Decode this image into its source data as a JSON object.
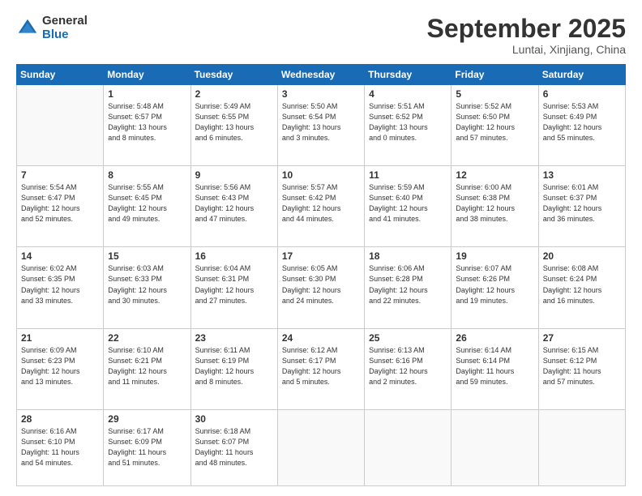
{
  "logo": {
    "general": "General",
    "blue": "Blue"
  },
  "header": {
    "month": "September 2025",
    "location": "Luntai, Xinjiang, China"
  },
  "weekdays": [
    "Sunday",
    "Monday",
    "Tuesday",
    "Wednesday",
    "Thursday",
    "Friday",
    "Saturday"
  ],
  "weeks": [
    [
      {
        "day": "",
        "info": ""
      },
      {
        "day": "1",
        "info": "Sunrise: 5:48 AM\nSunset: 6:57 PM\nDaylight: 13 hours\nand 8 minutes."
      },
      {
        "day": "2",
        "info": "Sunrise: 5:49 AM\nSunset: 6:55 PM\nDaylight: 13 hours\nand 6 minutes."
      },
      {
        "day": "3",
        "info": "Sunrise: 5:50 AM\nSunset: 6:54 PM\nDaylight: 13 hours\nand 3 minutes."
      },
      {
        "day": "4",
        "info": "Sunrise: 5:51 AM\nSunset: 6:52 PM\nDaylight: 13 hours\nand 0 minutes."
      },
      {
        "day": "5",
        "info": "Sunrise: 5:52 AM\nSunset: 6:50 PM\nDaylight: 12 hours\nand 57 minutes."
      },
      {
        "day": "6",
        "info": "Sunrise: 5:53 AM\nSunset: 6:49 PM\nDaylight: 12 hours\nand 55 minutes."
      }
    ],
    [
      {
        "day": "7",
        "info": "Sunrise: 5:54 AM\nSunset: 6:47 PM\nDaylight: 12 hours\nand 52 minutes."
      },
      {
        "day": "8",
        "info": "Sunrise: 5:55 AM\nSunset: 6:45 PM\nDaylight: 12 hours\nand 49 minutes."
      },
      {
        "day": "9",
        "info": "Sunrise: 5:56 AM\nSunset: 6:43 PM\nDaylight: 12 hours\nand 47 minutes."
      },
      {
        "day": "10",
        "info": "Sunrise: 5:57 AM\nSunset: 6:42 PM\nDaylight: 12 hours\nand 44 minutes."
      },
      {
        "day": "11",
        "info": "Sunrise: 5:59 AM\nSunset: 6:40 PM\nDaylight: 12 hours\nand 41 minutes."
      },
      {
        "day": "12",
        "info": "Sunrise: 6:00 AM\nSunset: 6:38 PM\nDaylight: 12 hours\nand 38 minutes."
      },
      {
        "day": "13",
        "info": "Sunrise: 6:01 AM\nSunset: 6:37 PM\nDaylight: 12 hours\nand 36 minutes."
      }
    ],
    [
      {
        "day": "14",
        "info": "Sunrise: 6:02 AM\nSunset: 6:35 PM\nDaylight: 12 hours\nand 33 minutes."
      },
      {
        "day": "15",
        "info": "Sunrise: 6:03 AM\nSunset: 6:33 PM\nDaylight: 12 hours\nand 30 minutes."
      },
      {
        "day": "16",
        "info": "Sunrise: 6:04 AM\nSunset: 6:31 PM\nDaylight: 12 hours\nand 27 minutes."
      },
      {
        "day": "17",
        "info": "Sunrise: 6:05 AM\nSunset: 6:30 PM\nDaylight: 12 hours\nand 24 minutes."
      },
      {
        "day": "18",
        "info": "Sunrise: 6:06 AM\nSunset: 6:28 PM\nDaylight: 12 hours\nand 22 minutes."
      },
      {
        "day": "19",
        "info": "Sunrise: 6:07 AM\nSunset: 6:26 PM\nDaylight: 12 hours\nand 19 minutes."
      },
      {
        "day": "20",
        "info": "Sunrise: 6:08 AM\nSunset: 6:24 PM\nDaylight: 12 hours\nand 16 minutes."
      }
    ],
    [
      {
        "day": "21",
        "info": "Sunrise: 6:09 AM\nSunset: 6:23 PM\nDaylight: 12 hours\nand 13 minutes."
      },
      {
        "day": "22",
        "info": "Sunrise: 6:10 AM\nSunset: 6:21 PM\nDaylight: 12 hours\nand 11 minutes."
      },
      {
        "day": "23",
        "info": "Sunrise: 6:11 AM\nSunset: 6:19 PM\nDaylight: 12 hours\nand 8 minutes."
      },
      {
        "day": "24",
        "info": "Sunrise: 6:12 AM\nSunset: 6:17 PM\nDaylight: 12 hours\nand 5 minutes."
      },
      {
        "day": "25",
        "info": "Sunrise: 6:13 AM\nSunset: 6:16 PM\nDaylight: 12 hours\nand 2 minutes."
      },
      {
        "day": "26",
        "info": "Sunrise: 6:14 AM\nSunset: 6:14 PM\nDaylight: 11 hours\nand 59 minutes."
      },
      {
        "day": "27",
        "info": "Sunrise: 6:15 AM\nSunset: 6:12 PM\nDaylight: 11 hours\nand 57 minutes."
      }
    ],
    [
      {
        "day": "28",
        "info": "Sunrise: 6:16 AM\nSunset: 6:10 PM\nDaylight: 11 hours\nand 54 minutes."
      },
      {
        "day": "29",
        "info": "Sunrise: 6:17 AM\nSunset: 6:09 PM\nDaylight: 11 hours\nand 51 minutes."
      },
      {
        "day": "30",
        "info": "Sunrise: 6:18 AM\nSunset: 6:07 PM\nDaylight: 11 hours\nand 48 minutes."
      },
      {
        "day": "",
        "info": ""
      },
      {
        "day": "",
        "info": ""
      },
      {
        "day": "",
        "info": ""
      },
      {
        "day": "",
        "info": ""
      }
    ]
  ]
}
